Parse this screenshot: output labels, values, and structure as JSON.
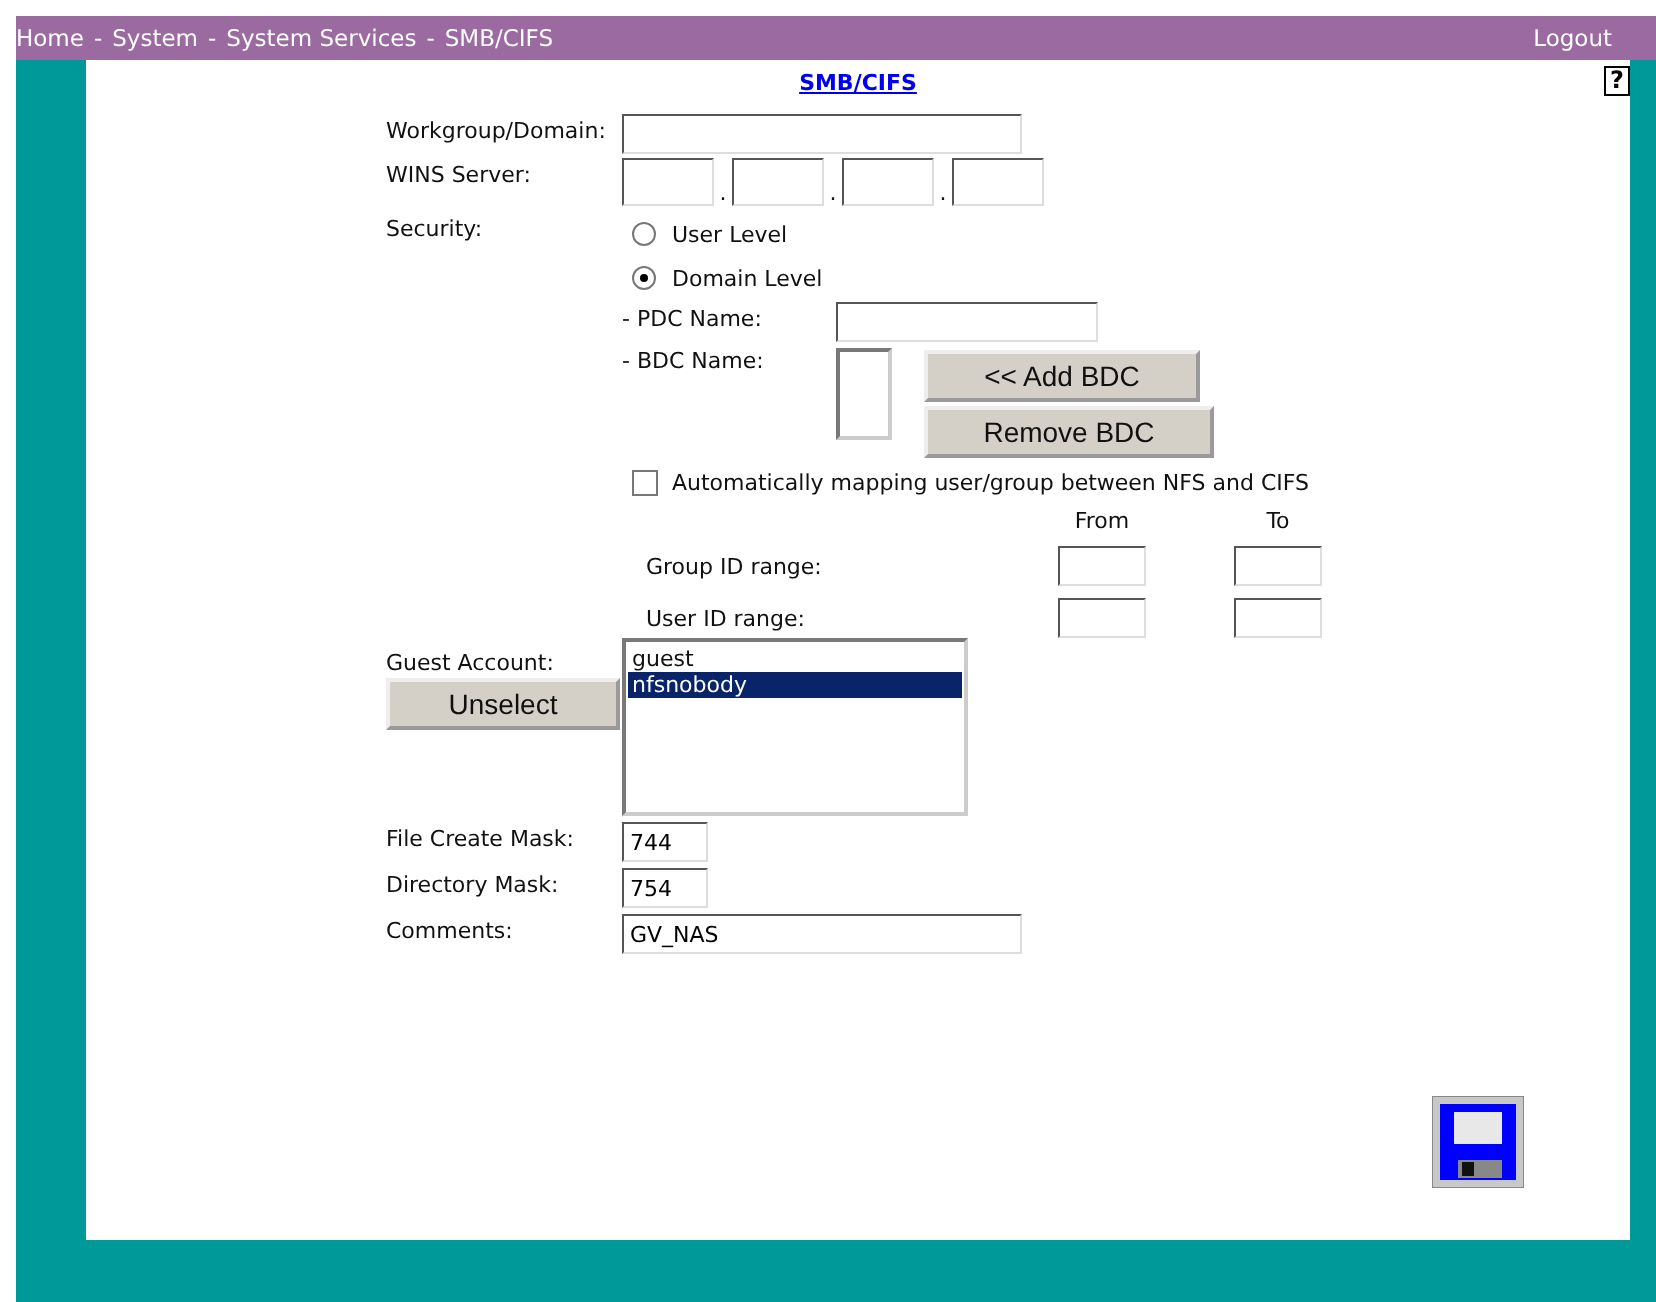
{
  "breadcrumb": {
    "items": [
      "Home",
      "System",
      "System Services",
      "SMB/CIFS"
    ],
    "separator": "-"
  },
  "logout": "Logout",
  "page_title": "SMB/CIFS",
  "help": "?",
  "workgroup": {
    "label": "Workgroup/Domain:"
  },
  "wins": {
    "label": "WINS Server:",
    "separators": [
      ".",
      ".",
      "."
    ]
  },
  "security": {
    "label": "Security:",
    "options": [
      {
        "label": "User Level",
        "selected": false
      },
      {
        "label": "Domain Level",
        "selected": true
      }
    ],
    "pdc": {
      "label": "- PDC Name:"
    },
    "bdc": {
      "label": "- BDC Name:",
      "buttons": [
        "<< Add BDC",
        "Remove BDC"
      ]
    }
  },
  "auto_mapping": {
    "label": "Automatically mapping user/group between NFS and CIFS",
    "checked": false
  },
  "id_ranges": {
    "headers": [
      "From",
      "To"
    ],
    "rows": [
      {
        "label": "Group ID range:"
      },
      {
        "label": "User ID range:"
      }
    ]
  },
  "guest": {
    "label": "Guest Account:",
    "button": "Unselect",
    "options": [
      {
        "label": "guest",
        "selected": false
      },
      {
        "label": "nfsnobody",
        "selected": true
      }
    ]
  },
  "file_create_mask": {
    "label": "File Create Mask:",
    "value": "744"
  },
  "directory_mask": {
    "label": "Directory Mask:",
    "value": "754"
  },
  "comments": {
    "label": "Comments:",
    "value": "GV_NAS"
  }
}
